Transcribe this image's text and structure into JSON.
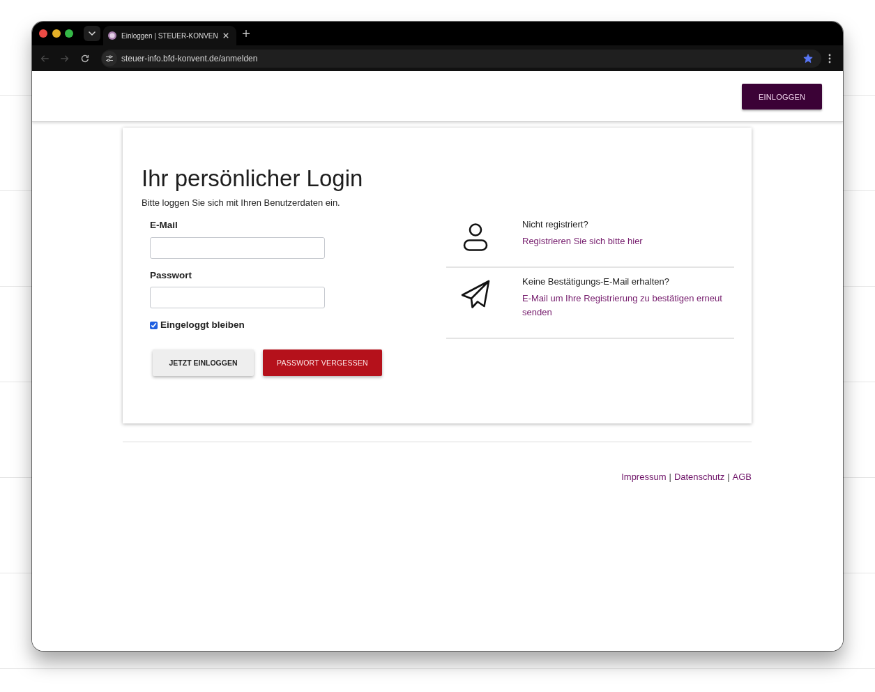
{
  "browser": {
    "tabs": [
      {
        "title": "Einloggen | STEUER-KONVEN",
        "selected": true
      }
    ],
    "back": {
      "disabled": true
    },
    "forward": {
      "disabled": true
    },
    "url": "steuer-info.bfd-konvent.de/anmelden",
    "bookmarked": true
  },
  "header": {
    "button": "EINLOGGEN"
  },
  "login": {
    "title": "Ihr persönlicher Login",
    "subtitle": "Bitte loggen Sie sich mit Ihren Benutzerdaten ein.",
    "fields": [
      {
        "label": "E-Mail"
      },
      {
        "label": "Passwort"
      }
    ],
    "remember": {
      "label": "Eingeloggt bleiben",
      "checked": true
    },
    "buttons": [
      {
        "kind": "secondary",
        "label": "JETZT EINLOGGEN"
      },
      {
        "kind": "danger",
        "label": "PASSWORT VERGESSEN"
      }
    ]
  },
  "help": [
    {
      "kind": "user",
      "question": "Nicht registriert?",
      "link": "Registrieren Sie sich bitte hier"
    },
    {
      "kind": "plane",
      "question": "Keine Bestätigungs-E-Mail erhalten?",
      "link": "E-Mail um Ihre Registrierung zu bestätigen erneut senden"
    }
  ],
  "footer": {
    "items": [
      {
        "kind": "link",
        "text": "Impressum"
      },
      {
        "kind": "separator",
        "text": "|"
      },
      {
        "kind": "link",
        "text": "Datenschutz"
      },
      {
        "kind": "separator",
        "text": "|"
      },
      {
        "kind": "link",
        "text": "AGB"
      }
    ]
  }
}
